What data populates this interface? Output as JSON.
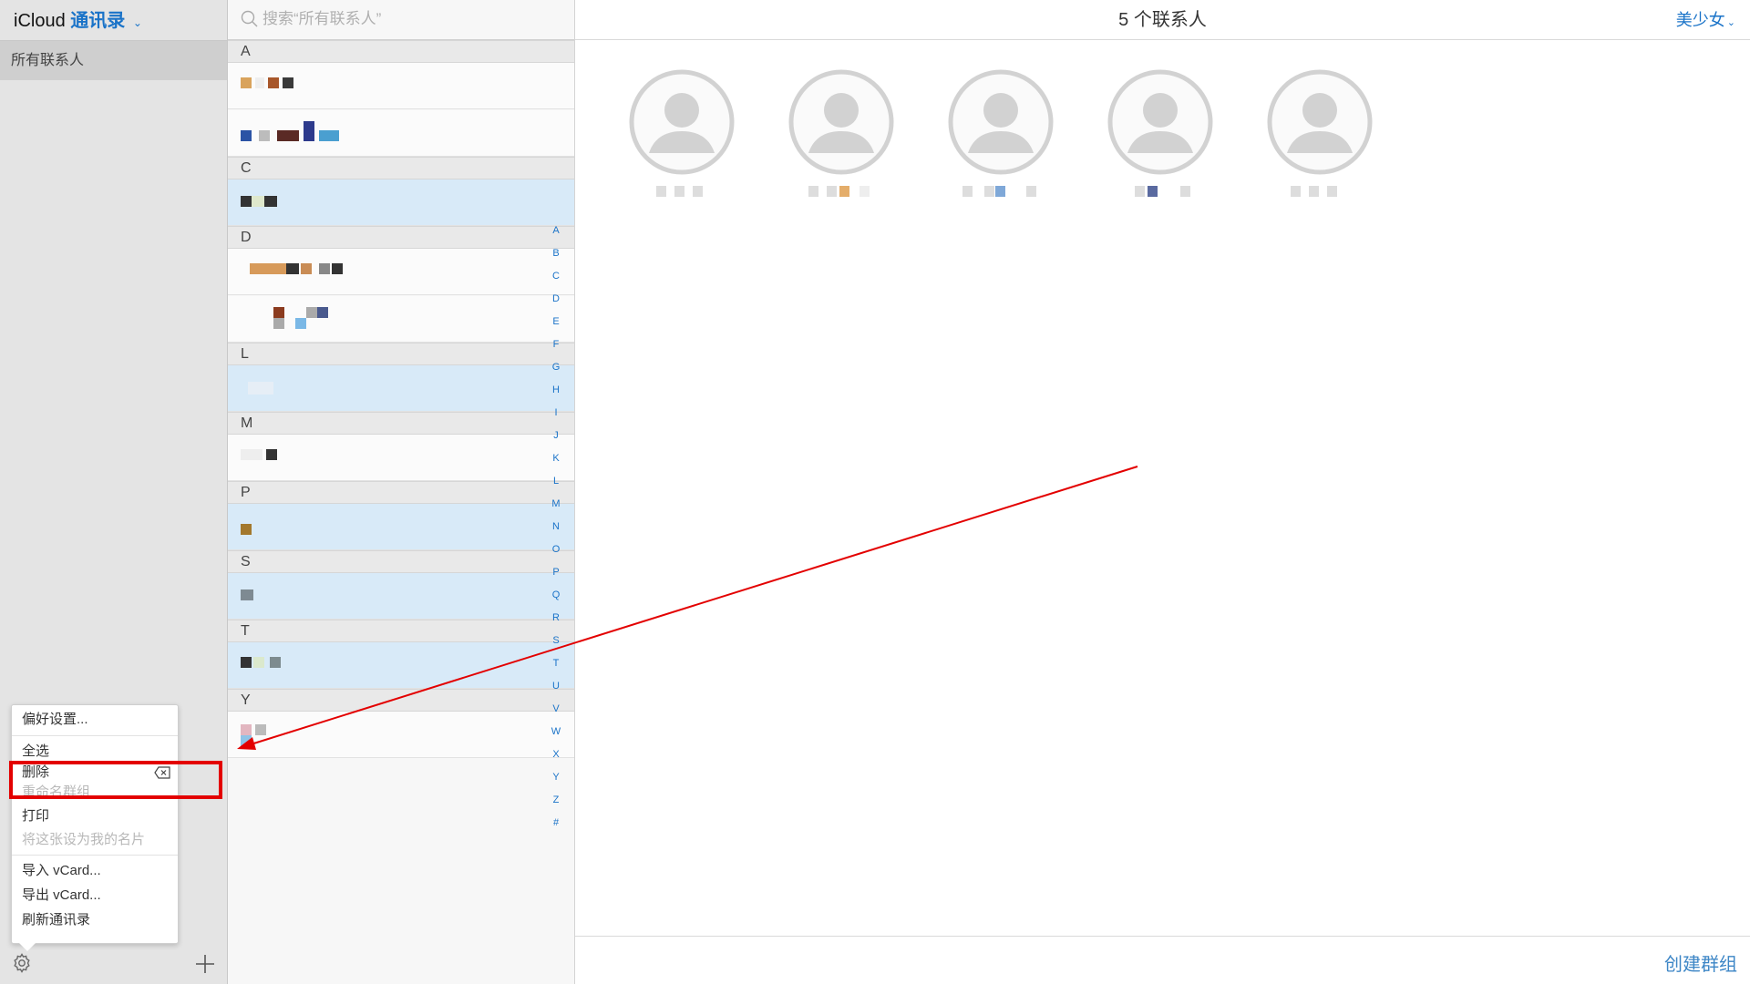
{
  "app": {
    "brand": "iCloud",
    "section": "通讯录",
    "chevron": "⌄"
  },
  "sidebar": {
    "groups": [
      {
        "label": "所有联系人",
        "selected": true
      }
    ],
    "gear_icon": "gear-icon",
    "add_icon": "plus-icon"
  },
  "settings_menu": {
    "items": [
      {
        "label": "偏好设置...",
        "enabled": true
      },
      {
        "label": "全选",
        "enabled": true
      },
      {
        "label": "删除",
        "enabled": true,
        "shortcut_icon": "delete-key-icon"
      },
      {
        "label": "重命名群组",
        "enabled": false
      },
      {
        "label": "打印",
        "enabled": true
      },
      {
        "label": "将这张设为我的名片",
        "enabled": false
      },
      {
        "label": "导入 vCard...",
        "enabled": true
      },
      {
        "label": "导出 vCard...",
        "enabled": true
      },
      {
        "label": "刷新通讯录",
        "enabled": true
      }
    ]
  },
  "search": {
    "placeholder": "搜索“所有联系人”",
    "value": ""
  },
  "contact_list": {
    "sections": [
      {
        "letter": "A",
        "rows": [
          {
            "selected": false
          },
          {
            "selected": false
          }
        ]
      },
      {
        "letter": "C",
        "rows": [
          {
            "selected": true
          }
        ]
      },
      {
        "letter": "D",
        "rows": [
          {
            "selected": false
          },
          {
            "selected": false
          }
        ]
      },
      {
        "letter": "L",
        "rows": [
          {
            "selected": true
          }
        ]
      },
      {
        "letter": "M",
        "rows": [
          {
            "selected": false,
            "has_card_icon": true
          }
        ]
      },
      {
        "letter": "P",
        "rows": [
          {
            "selected": true
          }
        ]
      },
      {
        "letter": "S",
        "rows": [
          {
            "selected": true
          }
        ]
      },
      {
        "letter": "T",
        "rows": [
          {
            "selected": true
          }
        ]
      },
      {
        "letter": "Y",
        "rows": [
          {
            "selected": false
          }
        ]
      }
    ],
    "alpha_index": [
      "A",
      "B",
      "C",
      "D",
      "E",
      "F",
      "G",
      "H",
      "I",
      "J",
      "K",
      "L",
      "M",
      "N",
      "O",
      "P",
      "Q",
      "R",
      "S",
      "T",
      "U",
      "V",
      "W",
      "X",
      "Y",
      "Z",
      "#"
    ]
  },
  "detail": {
    "count_label": "5 个联系人",
    "user_name": "美少女",
    "user_chevron": "⌄",
    "selected_avatars": 5,
    "create_group_label": "创建群组"
  },
  "annotation": {
    "highlight_color": "#e30000",
    "arrow_color": "#e30000"
  },
  "colors": {
    "accent": "#1a73c8",
    "selected_row": "#d8eaf8",
    "sidebar_bg": "#e4e4e4"
  }
}
